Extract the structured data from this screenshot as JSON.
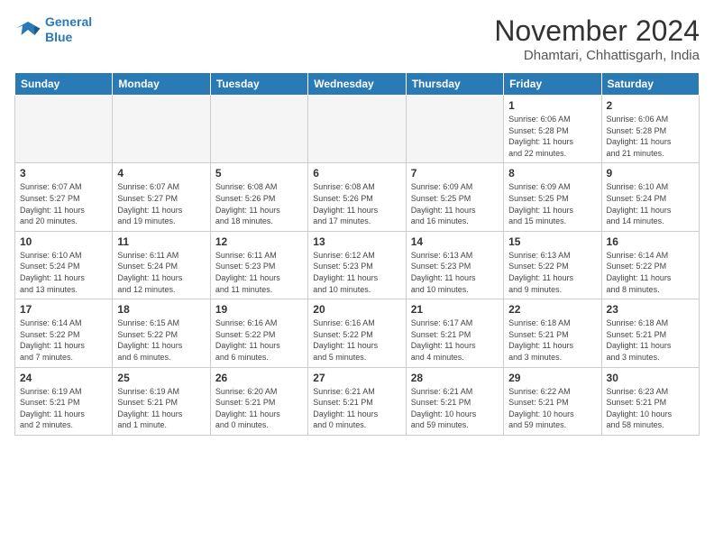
{
  "header": {
    "logo_line1": "General",
    "logo_line2": "Blue",
    "month_title": "November 2024",
    "location": "Dhamtari, Chhattisgarh, India"
  },
  "weekdays": [
    "Sunday",
    "Monday",
    "Tuesday",
    "Wednesday",
    "Thursday",
    "Friday",
    "Saturday"
  ],
  "weeks": [
    [
      {
        "day": "",
        "info": ""
      },
      {
        "day": "",
        "info": ""
      },
      {
        "day": "",
        "info": ""
      },
      {
        "day": "",
        "info": ""
      },
      {
        "day": "",
        "info": ""
      },
      {
        "day": "1",
        "info": "Sunrise: 6:06 AM\nSunset: 5:28 PM\nDaylight: 11 hours\nand 22 minutes."
      },
      {
        "day": "2",
        "info": "Sunrise: 6:06 AM\nSunset: 5:28 PM\nDaylight: 11 hours\nand 21 minutes."
      }
    ],
    [
      {
        "day": "3",
        "info": "Sunrise: 6:07 AM\nSunset: 5:27 PM\nDaylight: 11 hours\nand 20 minutes."
      },
      {
        "day": "4",
        "info": "Sunrise: 6:07 AM\nSunset: 5:27 PM\nDaylight: 11 hours\nand 19 minutes."
      },
      {
        "day": "5",
        "info": "Sunrise: 6:08 AM\nSunset: 5:26 PM\nDaylight: 11 hours\nand 18 minutes."
      },
      {
        "day": "6",
        "info": "Sunrise: 6:08 AM\nSunset: 5:26 PM\nDaylight: 11 hours\nand 17 minutes."
      },
      {
        "day": "7",
        "info": "Sunrise: 6:09 AM\nSunset: 5:25 PM\nDaylight: 11 hours\nand 16 minutes."
      },
      {
        "day": "8",
        "info": "Sunrise: 6:09 AM\nSunset: 5:25 PM\nDaylight: 11 hours\nand 15 minutes."
      },
      {
        "day": "9",
        "info": "Sunrise: 6:10 AM\nSunset: 5:24 PM\nDaylight: 11 hours\nand 14 minutes."
      }
    ],
    [
      {
        "day": "10",
        "info": "Sunrise: 6:10 AM\nSunset: 5:24 PM\nDaylight: 11 hours\nand 13 minutes."
      },
      {
        "day": "11",
        "info": "Sunrise: 6:11 AM\nSunset: 5:24 PM\nDaylight: 11 hours\nand 12 minutes."
      },
      {
        "day": "12",
        "info": "Sunrise: 6:11 AM\nSunset: 5:23 PM\nDaylight: 11 hours\nand 11 minutes."
      },
      {
        "day": "13",
        "info": "Sunrise: 6:12 AM\nSunset: 5:23 PM\nDaylight: 11 hours\nand 10 minutes."
      },
      {
        "day": "14",
        "info": "Sunrise: 6:13 AM\nSunset: 5:23 PM\nDaylight: 11 hours\nand 10 minutes."
      },
      {
        "day": "15",
        "info": "Sunrise: 6:13 AM\nSunset: 5:22 PM\nDaylight: 11 hours\nand 9 minutes."
      },
      {
        "day": "16",
        "info": "Sunrise: 6:14 AM\nSunset: 5:22 PM\nDaylight: 11 hours\nand 8 minutes."
      }
    ],
    [
      {
        "day": "17",
        "info": "Sunrise: 6:14 AM\nSunset: 5:22 PM\nDaylight: 11 hours\nand 7 minutes."
      },
      {
        "day": "18",
        "info": "Sunrise: 6:15 AM\nSunset: 5:22 PM\nDaylight: 11 hours\nand 6 minutes."
      },
      {
        "day": "19",
        "info": "Sunrise: 6:16 AM\nSunset: 5:22 PM\nDaylight: 11 hours\nand 6 minutes."
      },
      {
        "day": "20",
        "info": "Sunrise: 6:16 AM\nSunset: 5:22 PM\nDaylight: 11 hours\nand 5 minutes."
      },
      {
        "day": "21",
        "info": "Sunrise: 6:17 AM\nSunset: 5:21 PM\nDaylight: 11 hours\nand 4 minutes."
      },
      {
        "day": "22",
        "info": "Sunrise: 6:18 AM\nSunset: 5:21 PM\nDaylight: 11 hours\nand 3 minutes."
      },
      {
        "day": "23",
        "info": "Sunrise: 6:18 AM\nSunset: 5:21 PM\nDaylight: 11 hours\nand 3 minutes."
      }
    ],
    [
      {
        "day": "24",
        "info": "Sunrise: 6:19 AM\nSunset: 5:21 PM\nDaylight: 11 hours\nand 2 minutes."
      },
      {
        "day": "25",
        "info": "Sunrise: 6:19 AM\nSunset: 5:21 PM\nDaylight: 11 hours\nand 1 minute."
      },
      {
        "day": "26",
        "info": "Sunrise: 6:20 AM\nSunset: 5:21 PM\nDaylight: 11 hours\nand 0 minutes."
      },
      {
        "day": "27",
        "info": "Sunrise: 6:21 AM\nSunset: 5:21 PM\nDaylight: 11 hours\nand 0 minutes."
      },
      {
        "day": "28",
        "info": "Sunrise: 6:21 AM\nSunset: 5:21 PM\nDaylight: 10 hours\nand 59 minutes."
      },
      {
        "day": "29",
        "info": "Sunrise: 6:22 AM\nSunset: 5:21 PM\nDaylight: 10 hours\nand 59 minutes."
      },
      {
        "day": "30",
        "info": "Sunrise: 6:23 AM\nSunset: 5:21 PM\nDaylight: 10 hours\nand 58 minutes."
      }
    ]
  ]
}
